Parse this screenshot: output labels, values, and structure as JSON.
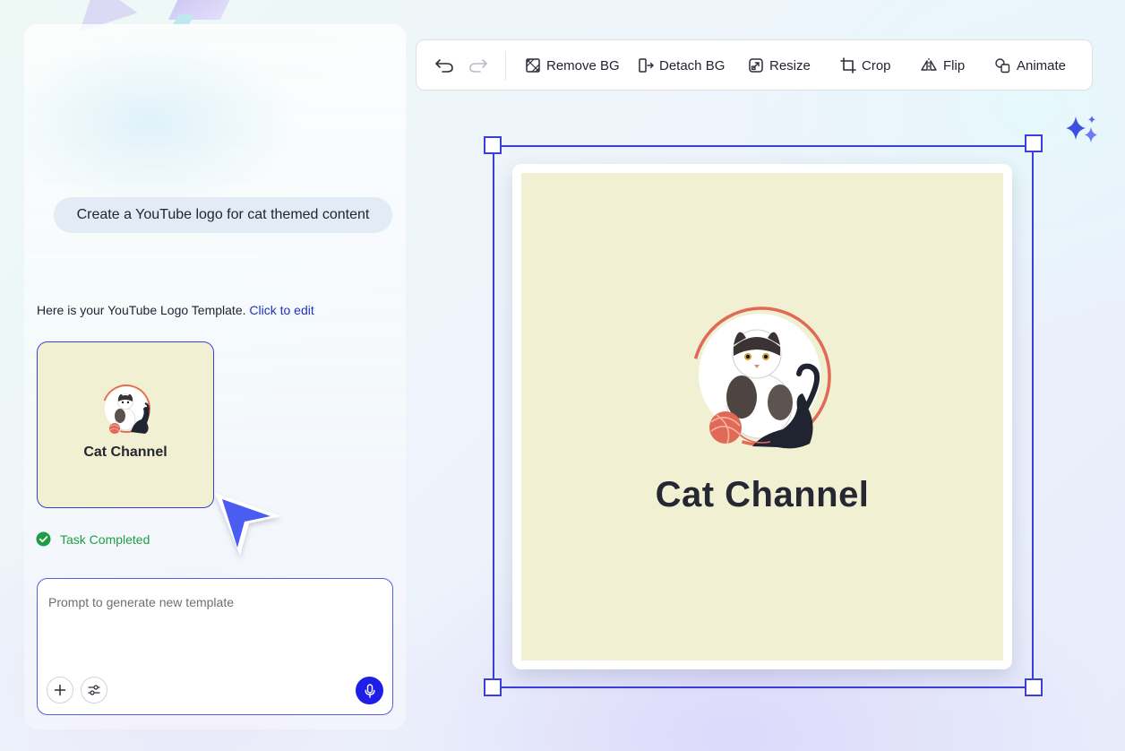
{
  "chat": {
    "user_message": "Create a YouTube logo for cat themed content",
    "reply_text": "Here is your YouTube Logo Template.",
    "reply_link": "Click to edit",
    "thumbnail_title": "Cat Channel",
    "task_status": "Task Completed"
  },
  "prompt": {
    "placeholder": "Prompt to generate new template"
  },
  "toolbar": {
    "remove_bg": "Remove BG",
    "detach_bg": "Detach BG",
    "resize": "Resize",
    "crop": "Crop",
    "flip": "Flip",
    "animate": "Animate"
  },
  "canvas": {
    "design_title": "Cat Channel",
    "background_color": "#f1f0d2"
  },
  "colors": {
    "accent": "#3b3fd9",
    "link": "#2131c8",
    "success": "#1f9d46",
    "mic_button": "#1e1ee6"
  }
}
